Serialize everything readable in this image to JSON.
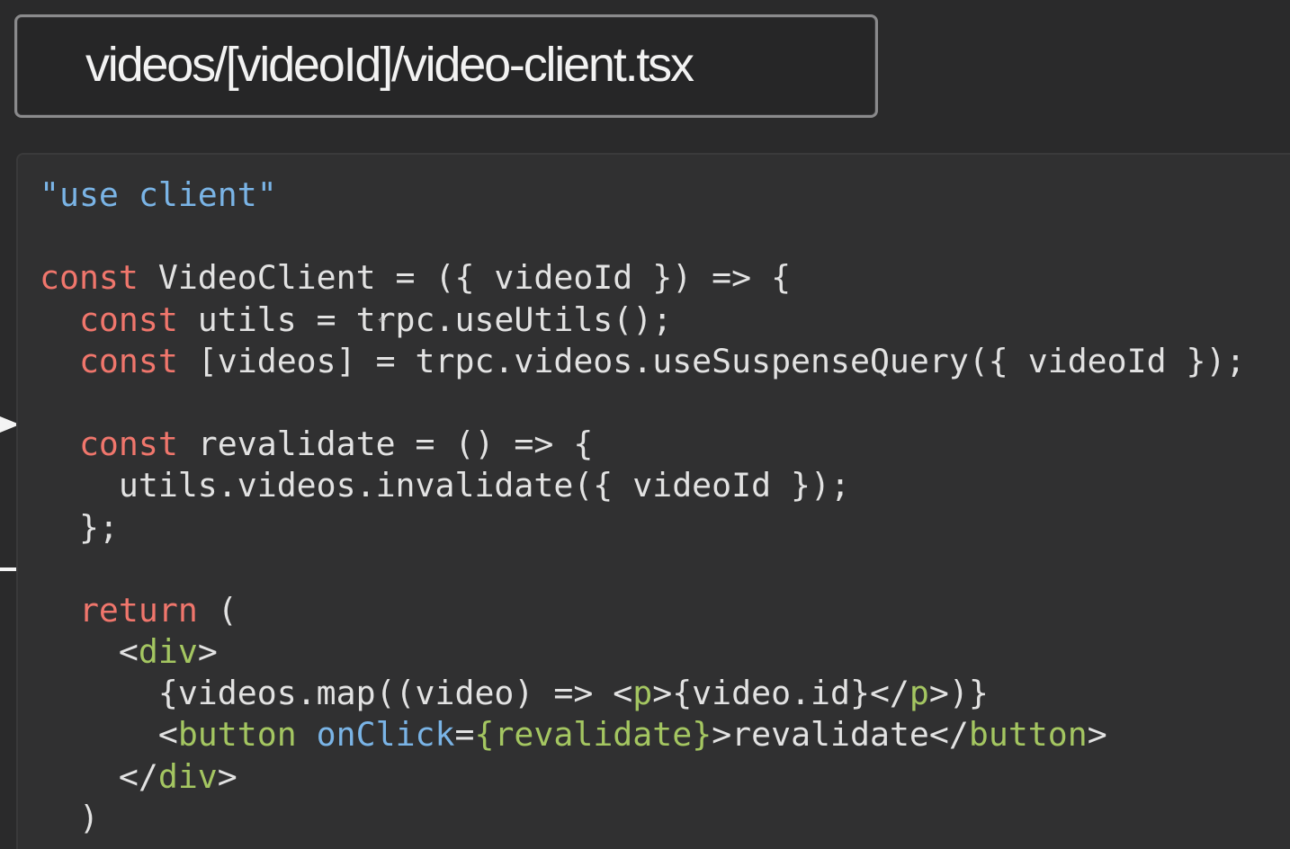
{
  "file_tab": {
    "title": "videos/[videoId]/video-client.tsx"
  },
  "code_lines": [
    {
      "tokens": [
        {
          "t": "\"use client\"",
          "c": "str"
        }
      ]
    },
    {
      "tokens": []
    },
    {
      "tokens": [
        {
          "t": "const",
          "c": "kw"
        },
        {
          "t": " VideoClient = ({ videoId }) => {",
          "c": "plain"
        }
      ]
    },
    {
      "tokens": [
        {
          "t": "  "
        },
        {
          "t": "const",
          "c": "kw"
        },
        {
          "t": " utils = trpc.useUtils();",
          "c": "plain"
        }
      ]
    },
    {
      "tokens": [
        {
          "t": "  "
        },
        {
          "t": "const",
          "c": "kw"
        },
        {
          "t": " [videos] = trpc.videos.useSuspenseQuery({ videoId });",
          "c": "plain"
        }
      ]
    },
    {
      "tokens": []
    },
    {
      "tokens": [
        {
          "t": "  "
        },
        {
          "t": "const",
          "c": "kw"
        },
        {
          "t": " revalidate = () => {",
          "c": "plain"
        }
      ]
    },
    {
      "tokens": [
        {
          "t": "    utils.videos.invalidate({ videoId });",
          "c": "plain"
        }
      ]
    },
    {
      "tokens": [
        {
          "t": "  };",
          "c": "plain"
        }
      ]
    },
    {
      "tokens": []
    },
    {
      "tokens": [
        {
          "t": "  "
        },
        {
          "t": "return",
          "c": "kw"
        },
        {
          "t": " (",
          "c": "plain"
        }
      ]
    },
    {
      "tokens": [
        {
          "t": "    <",
          "c": "plain"
        },
        {
          "t": "div",
          "c": "tag"
        },
        {
          "t": ">",
          "c": "plain"
        }
      ]
    },
    {
      "tokens": [
        {
          "t": "      {videos.map((video) => <",
          "c": "plain"
        },
        {
          "t": "p",
          "c": "tag"
        },
        {
          "t": ">{video.id}</",
          "c": "plain"
        },
        {
          "t": "p",
          "c": "tag"
        },
        {
          "t": ">)}",
          "c": "plain"
        }
      ]
    },
    {
      "tokens": [
        {
          "t": "      <",
          "c": "plain"
        },
        {
          "t": "button",
          "c": "tag"
        },
        {
          "t": " ",
          "c": "plain"
        },
        {
          "t": "onClick",
          "c": "attr"
        },
        {
          "t": "=",
          "c": "plain"
        },
        {
          "t": "{revalidate}",
          "c": "expr"
        },
        {
          "t": ">revalidate</",
          "c": "plain"
        },
        {
          "t": "button",
          "c": "tag"
        },
        {
          "t": ">",
          "c": "plain"
        }
      ]
    },
    {
      "tokens": [
        {
          "t": "    </",
          "c": "plain"
        },
        {
          "t": "div",
          "c": "tag"
        },
        {
          "t": ">",
          "c": "plain"
        }
      ]
    },
    {
      "tokens": [
        {
          "t": "  )",
          "c": "plain"
        }
      ]
    }
  ],
  "colors": {
    "background": "#2a2a2b",
    "panel": "#303031",
    "keyword": "#f0766c",
    "string": "#7ab4e6",
    "jsx_tag": "#a4c661",
    "text": "#e2e2e2"
  },
  "icons": {
    "gutter_arrow": "play-arrow-icon",
    "gutter_dash": "dash-icon",
    "text_cursor": "crosshair-cursor-icon"
  }
}
